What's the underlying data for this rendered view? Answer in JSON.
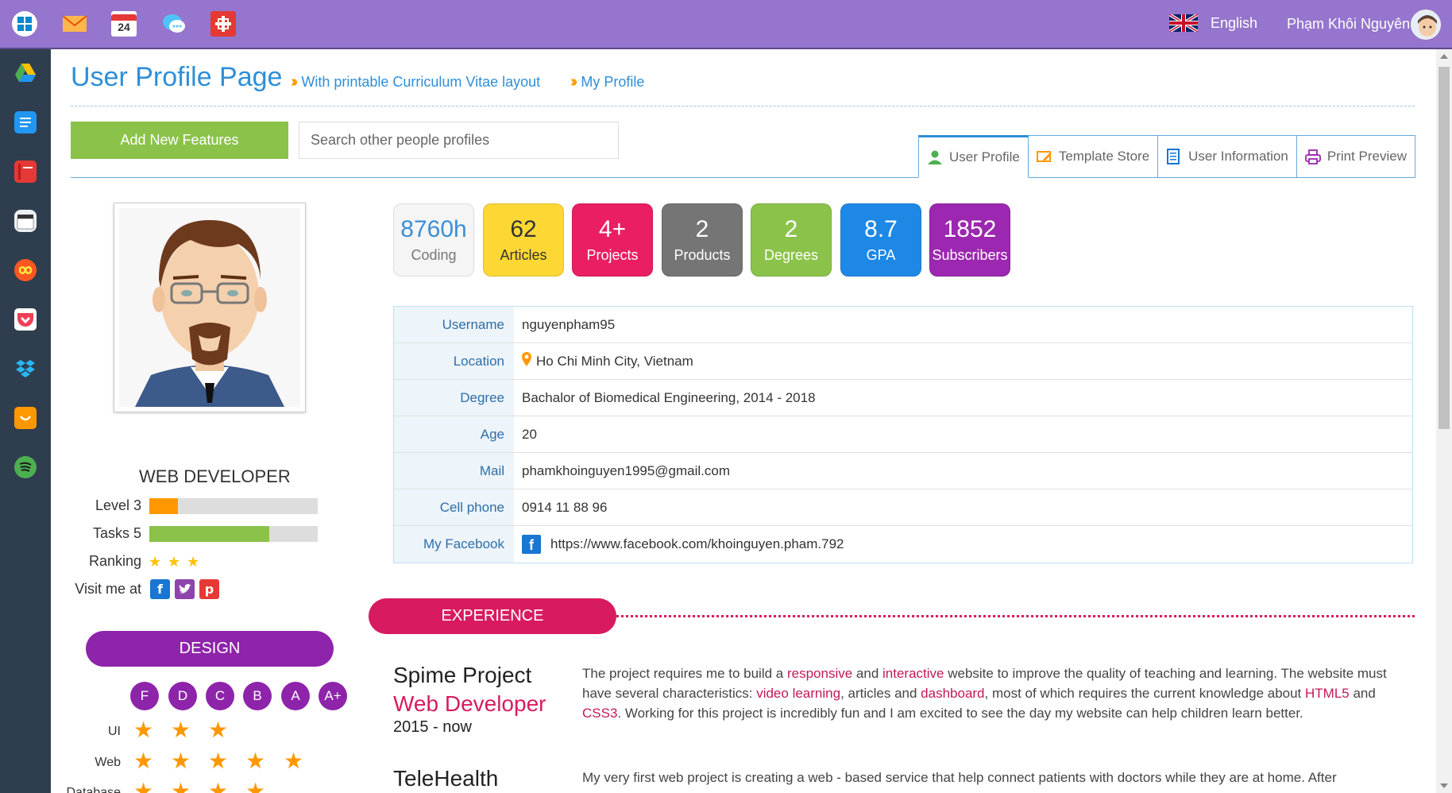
{
  "topbar": {
    "apps": [
      "windows-icon",
      "mail-icon",
      "calendar-icon",
      "chat-icon",
      "gift-icon"
    ],
    "calendar_day": "24",
    "language": "English",
    "user_name": "Phạm Khôi Nguyên"
  },
  "dock": {
    "apps": [
      "google-drive-icon",
      "docs-icon",
      "book-icon",
      "clapper-icon",
      "infinity-icon",
      "pocket-icon",
      "dropbox-icon",
      "shop-icon",
      "spotify-icon"
    ]
  },
  "header": {
    "title": "User Profile Page",
    "breadcrumb": [
      "With printable Curriculum Vitae layout",
      "My Profile"
    ],
    "add_button": "Add New Features",
    "search_placeholder": "Search other people profiles"
  },
  "tabs": [
    {
      "label": "User Profile",
      "active": true
    },
    {
      "label": "Template Store",
      "active": false
    },
    {
      "label": "User Information",
      "active": false
    },
    {
      "label": "Print Preview",
      "active": false
    }
  ],
  "profile": {
    "role": "WEB DEVELOPER",
    "level_label": "Level 3",
    "level_fraction": 0.17,
    "tasks_label": "Tasks 5",
    "tasks_fraction": 0.71,
    "ranking_label": "Ranking",
    "ranking_stars": 3,
    "visit_label": "Visit me at"
  },
  "design": {
    "title": "DESIGN",
    "grades": [
      "F",
      "D",
      "C",
      "B",
      "A",
      "A+"
    ],
    "skills": [
      {
        "name": "UI",
        "stars": 3
      },
      {
        "name": "Web",
        "stars": 5
      },
      {
        "name": "Database",
        "stars": 4
      }
    ]
  },
  "stats": [
    {
      "value": "8760h",
      "label": "Coding",
      "color": "#f5f5f5"
    },
    {
      "value": "62",
      "label": "Articles",
      "color": "#fdd835"
    },
    {
      "value": "4+",
      "label": "Projects",
      "color": "#e91e63"
    },
    {
      "value": "2",
      "label": "Products",
      "color": "#757575"
    },
    {
      "value": "2",
      "label": "Degrees",
      "color": "#8bc34a"
    },
    {
      "value": "8.7",
      "label": "GPA",
      "color": "#1e88e5"
    },
    {
      "value": "1852",
      "label": "Subscribers",
      "color": "#9c27b0"
    }
  ],
  "info": {
    "username_key": "Username",
    "username": "nguyenpham95",
    "location_key": "Location",
    "location": "Ho Chi Minh City, Vietnam",
    "degree_key": "Degree",
    "degree": "Bachalor of Biomedical Engineering, 2014 - 2018",
    "age_key": "Age",
    "age": "20",
    "mail_key": "Mail",
    "mail": "phamkhoinguyen1995@gmail.com",
    "phone_key": "Cell phone",
    "phone": "0914 11 88 96",
    "facebook_key": "My Facebook",
    "facebook": "https://www.facebook.com/khoinguyen.pham.792"
  },
  "experience": {
    "title": "EXPERIENCE",
    "projects": [
      {
        "name": "Spime Project",
        "role": "Web Developer",
        "date": "2015 - now",
        "desc": {
          "t1": "The project requires me to build a ",
          "h1": "responsive",
          "t2": " and ",
          "h2": "interactive",
          "t3": " website to improve the quality of teaching and learning. The website must have several characteristics: ",
          "h3": "video learning",
          "t4": ", articles and ",
          "h4": "dashboard",
          "t5": ", most of which requires the current knowledge about ",
          "h5": "HTML5",
          "t6": " and ",
          "h6": "CSS3",
          "t7": ". Working for this project is incredibly fun and I am excited to see the day my website can help children learn better."
        }
      },
      {
        "name": "TeleHealth",
        "desc_text": "My very first web project is creating a web - based service that help connect patients with doctors while they are at home. After"
      }
    ]
  },
  "colors": {
    "topbar": "#9575cd",
    "dock": "#2f3e4e",
    "accent_blue": "#2e8fd8",
    "experience": "#d81b60",
    "design": "#8e24aa"
  }
}
